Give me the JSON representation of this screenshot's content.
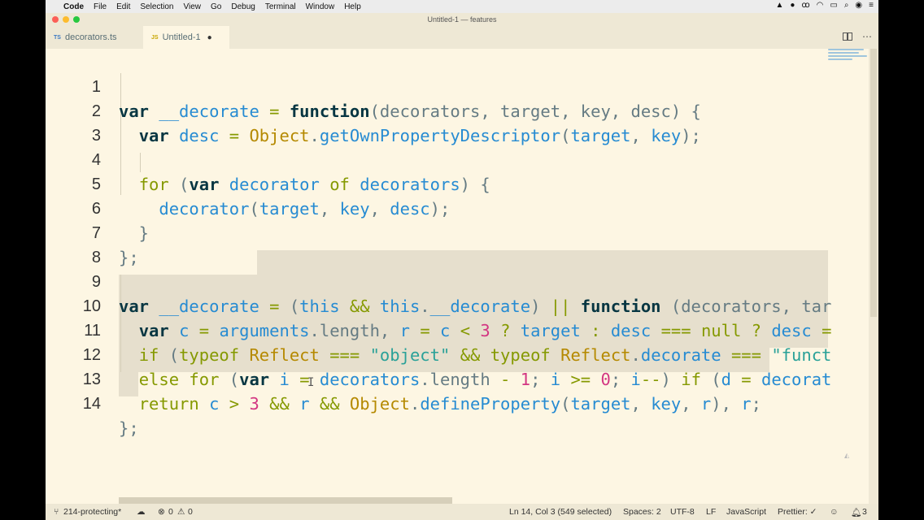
{
  "menubar": {
    "apple": "",
    "items": [
      "Code",
      "File",
      "Edit",
      "Selection",
      "View",
      "Go",
      "Debug",
      "Terminal",
      "Window",
      "Help"
    ],
    "right_icons": [
      "tray-icon",
      "record-icon",
      "glasses-icon",
      "wifi-icon",
      "battery-icon",
      "search-icon",
      "siri-icon",
      "list-icon"
    ]
  },
  "window": {
    "title": "Untitled-1 — features"
  },
  "tabs": [
    {
      "badge": "TS",
      "label": "decorators.ts",
      "dirty": false
    },
    {
      "badge": "JS",
      "label": "Untitled-1",
      "dirty": true,
      "dirty_mark": "●"
    }
  ],
  "editor": {
    "line_numbers": [
      "1",
      "2",
      "3",
      "4",
      "5",
      "6",
      "7",
      "8",
      "9",
      "10",
      "11",
      "12",
      "13",
      "14"
    ]
  },
  "status": {
    "branch": "214-protecting*",
    "sync": "",
    "errors": "0",
    "warnings": "0",
    "position": "Ln 14, Col 3 (549 selected)",
    "spaces": "Spaces: 2",
    "encoding": "UTF-8",
    "eol": "LF",
    "language": "JavaScript",
    "formatter": "Prettier: ✓",
    "notifications": "3"
  },
  "colors": {
    "background": "#fdf6e3",
    "keyword_blue": "#268bd2",
    "keyword_green": "#859900",
    "string": "#2aa198",
    "number": "#d33682",
    "selection": "#e6dfcd"
  }
}
